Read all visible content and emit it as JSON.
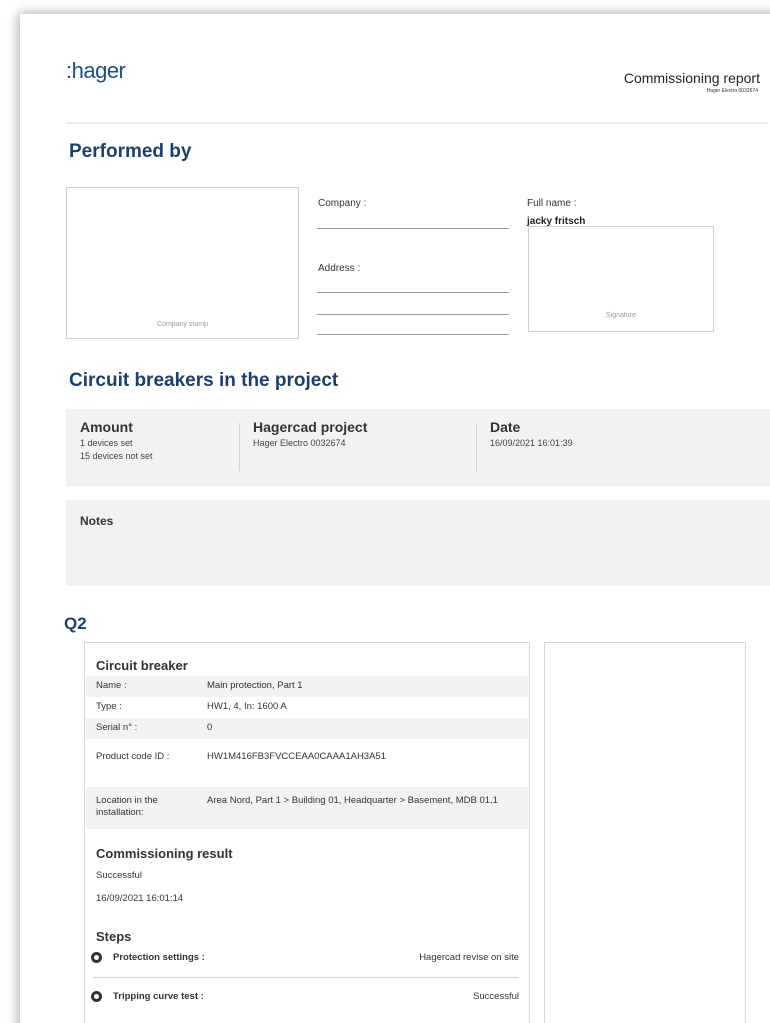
{
  "header": {
    "logo": ":hager",
    "title": "Commissioning report",
    "subtitle": "Hager Electro 0032674"
  },
  "performed_by": {
    "heading": "Performed by",
    "company_stamp_label": "Company stamp",
    "company_label": "Company :",
    "address_label": "Address :",
    "full_name_label": "Full name :",
    "full_name_value": "jacky fritsch",
    "signature_label": "Signature"
  },
  "project": {
    "heading": "Circuit breakers in the project",
    "amount_title": "Amount",
    "amount_set": "1 devices set",
    "amount_not_set": "15 devices not set",
    "hagercad_title": "Hagercad project",
    "hagercad_value": "Hager Electro 0032674",
    "date_title": "Date",
    "date_value": "16/09/2021 16:01:39",
    "notes_title": "Notes"
  },
  "device": {
    "heading": "Q2",
    "cb_heading": "Circuit breaker",
    "rows": [
      {
        "label": "Name :",
        "value": "Main protection, Part 1"
      },
      {
        "label": "Type :",
        "value": "HW1, 4, In: 1600 A"
      },
      {
        "label": "Serial n° :",
        "value": "0"
      },
      {
        "label": "Product code ID :",
        "value": "HW1M416FB3FVCCEAA0CAAA1AH3A51"
      },
      {
        "label": "Location in the installation:",
        "value": "Area Nord, Part 1 > Building 01, Headquarter > Basement, MDB 01.1"
      }
    ],
    "result_heading": "Commissioning result",
    "result_status": "Successful",
    "result_date": "16/09/2021 16:01:14",
    "steps_heading": "Steps",
    "steps": [
      {
        "name": "Protection settings :",
        "result": "Hagercad revise on site"
      },
      {
        "name": "Tripping curve test :",
        "result": "Successful"
      }
    ]
  },
  "colors": {
    "heading_blue": "#1d3f6e",
    "panel_gray": "#f2f2f0"
  },
  "icons": [
    "step-status-icon"
  ]
}
